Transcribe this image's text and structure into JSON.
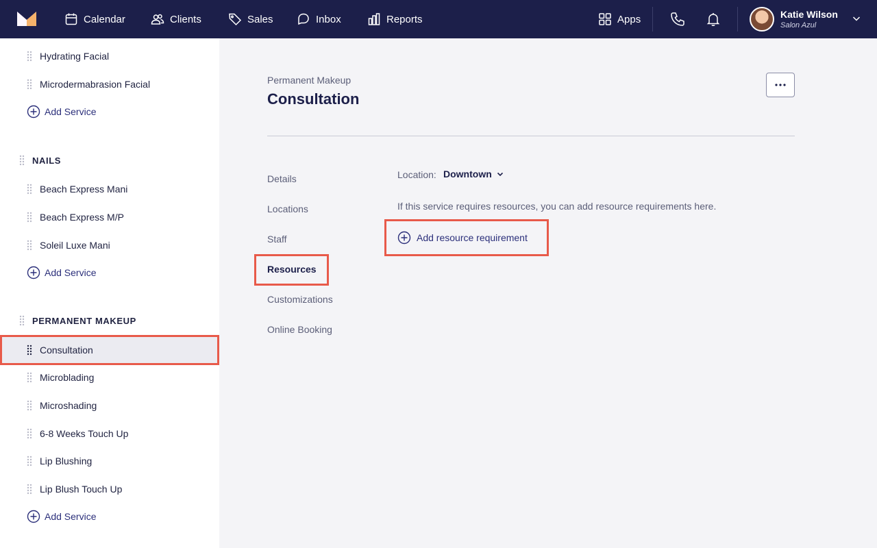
{
  "nav": {
    "logo": "logo-icon",
    "items": [
      {
        "label": "Calendar",
        "icon": "calendar-icon"
      },
      {
        "label": "Clients",
        "icon": "users-icon"
      },
      {
        "label": "Sales",
        "icon": "tag-icon"
      },
      {
        "label": "Inbox",
        "icon": "chat-icon"
      },
      {
        "label": "Reports",
        "icon": "bar-chart-icon"
      }
    ],
    "apps_label": "Apps",
    "user": {
      "name": "Katie Wilson",
      "business": "Salon Azul"
    }
  },
  "sidebar": {
    "group_top_items": [
      "Hydrating Facial",
      "Microdermabrasion Facial"
    ],
    "add_service_label": "Add Service",
    "nails": {
      "header": "NAILS",
      "items": [
        "Beach Express Mani",
        "Beach Express M/P",
        "Soleil Luxe Mani"
      ]
    },
    "permanent_makeup": {
      "header": "PERMANENT MAKEUP",
      "items": [
        "Consultation",
        "Microblading",
        "Microshading",
        "6-8 Weeks Touch Up",
        "Lip Blushing",
        "Lip Blush Touch Up"
      ]
    }
  },
  "main": {
    "breadcrumb": "Permanent Makeup",
    "title": "Consultation",
    "tabs": [
      "Details",
      "Locations",
      "Staff",
      "Resources",
      "Customizations",
      "Online Booking"
    ],
    "active_tab": "Resources",
    "location_label": "Location:",
    "location_value": "Downtown",
    "info": "If this service requires resources, you can add resource requirements here.",
    "add_requirement_label": "Add resource requirement"
  },
  "colors": {
    "nav_bg": "#1c1f4a",
    "highlight": "#e85a4a",
    "accent": "#2b2f7a"
  }
}
